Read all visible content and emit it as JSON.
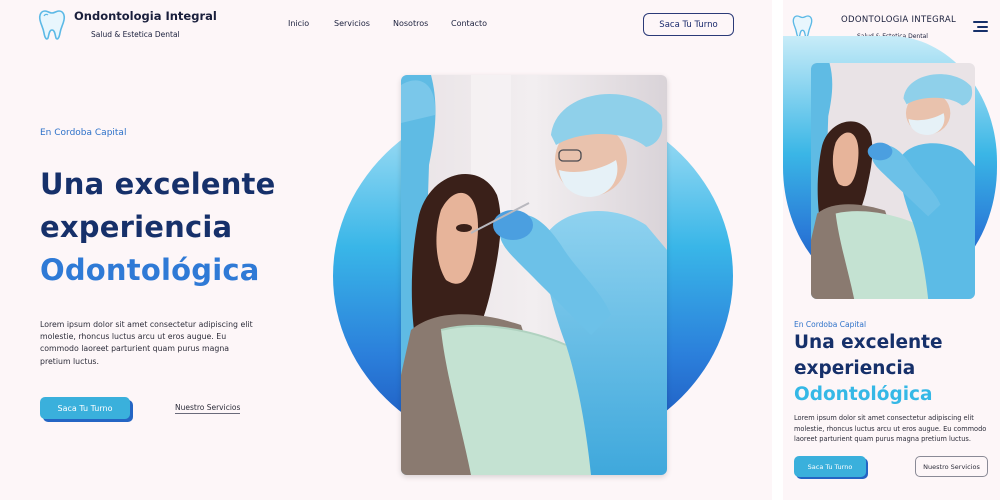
{
  "desktop": {
    "brand": {
      "title": "Ondontologia Integral",
      "subtitle": "Salud & Estetica Dental",
      "logo_icon": "tooth-icon"
    },
    "nav": [
      {
        "label": "Inicio"
      },
      {
        "label": "Servicios"
      },
      {
        "label": "Nosotros"
      },
      {
        "label": "Contacto"
      }
    ],
    "cta_header": "Saca Tu Turno",
    "hero": {
      "tagline": "En Cordoba Capital",
      "headline_line1": "Una excelente",
      "headline_line2": "experiencia",
      "headline_line3": "Odontológica",
      "body": "Lorem ipsum dolor sit amet consectetur adipiscing elit molestie, rhoncus luctus arcu ut eros augue. Eu commodo laoreet parturient quam purus magna pretium luctus.",
      "primary_button": "Saca Tu Turno",
      "secondary_link": "Nuestro Servicios"
    }
  },
  "mobile": {
    "brand": {
      "title": "ODONTOLOGIA INTEGRAL",
      "subtitle": "Salud & Estetica Dental",
      "logo_icon": "tooth-icon"
    },
    "menu_icon": "hamburger-menu-icon",
    "hero": {
      "tagline": "En Cordoba Capital",
      "headline_line1": "Una excelente",
      "headline_line2": "experiencia",
      "headline_line3": "Odontológica",
      "body": "Lorem ipsum dolor sit amet consectetur adipiscing elit molestie, rhoncus luctus arcu ut eros augue. Eu commodo laoreet parturient quam purus magna pretium luctus.",
      "primary_button": "Saca Tu Turno",
      "secondary_button": "Nuestro Servicios"
    }
  },
  "colors": {
    "navy": "#16306a",
    "accent_blue": "#2f7ad6",
    "cyan": "#3ab0dc",
    "background": "#fdf6f8"
  }
}
